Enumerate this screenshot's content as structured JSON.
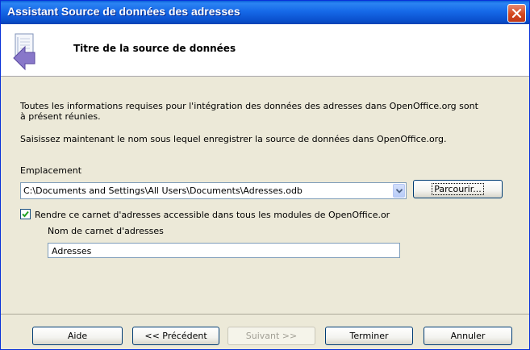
{
  "window": {
    "title": "Assistant Source de données des adresses"
  },
  "header": {
    "title": "Titre de la source de données"
  },
  "intro": {
    "line1": "Toutes les informations requises pour l'intégration des données des adresses dans OpenOffice.org sont",
    "line2": "à présent réunies.",
    "instruction": "Saisissez maintenant le nom sous lequel enregistrer la source de données dans OpenOffice.org."
  },
  "location": {
    "label": "Emplacement",
    "value": "C:\\Documents and Settings\\All Users\\Documents\\Adresses.odb",
    "browse_label": "Parcourir..."
  },
  "embed": {
    "checked": true,
    "label": "Rendre ce carnet d'adresses accessible dans tous les modules de OpenOffice.or",
    "name_label": "Nom de carnet d'adresses",
    "name_value": "Adresses"
  },
  "buttons": {
    "help": "Aide",
    "back": "<< Précédent",
    "next": "Suivant >>",
    "finish": "Terminer",
    "cancel": "Annuler"
  },
  "icons": {
    "close": "close-icon",
    "header": "wizard-page-icon",
    "dropdown": "chevron-down-icon",
    "check": "checkmark-icon"
  }
}
